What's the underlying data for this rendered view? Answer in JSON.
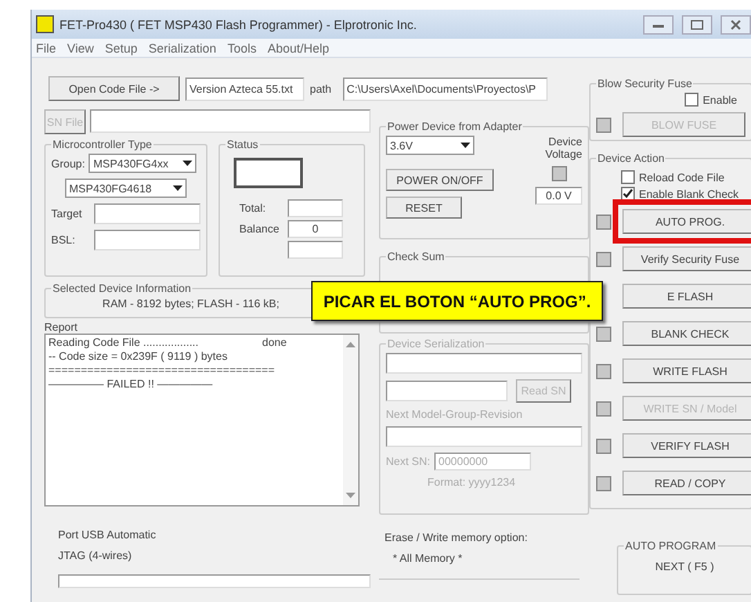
{
  "window": {
    "title": "FET-Pro430  ( FET MSP430 Flash Programmer)  -  Elprotronic Inc."
  },
  "menu": [
    "File",
    "View",
    "Setup",
    "Serialization",
    "Tools",
    "About/Help"
  ],
  "code_file": {
    "button": "Open Code File    ->",
    "file": "Version Azteca 55.txt",
    "path_label": "path",
    "path": "C:\\Users\\Axel\\Documents\\Proyectos\\P"
  },
  "sn_file": {
    "button": "SN File",
    "disabled": true
  },
  "microcontroller_type": {
    "title": "Microcontroller Type",
    "group_label": "Group:",
    "group": "MSP430FG4xx",
    "device": "MSP430FG4618",
    "target_label": "Target",
    "bsl_label": "BSL:"
  },
  "status": {
    "title": "Status",
    "total_label": "Total:",
    "balance_label": "Balance",
    "balance": "0"
  },
  "device_info": {
    "title": "Selected Device Information",
    "text": "RAM - 8192 bytes;    FLASH - 116 kB;"
  },
  "report": {
    "title": "Report",
    "lines": [
      {
        "text": "Reading Code File ..................",
        "result": "done"
      },
      {
        "text": "-- Code size = 0x239F ( 9119 ) bytes"
      },
      {
        "text": "==================================="
      },
      {
        "text": "————— FAILED !! —————"
      }
    ]
  },
  "power": {
    "title": "Power Device from Adapter",
    "voltage": "3.6V",
    "voltage_label": "Device Voltage",
    "power_button": "POWER ON/OFF",
    "reset_button": "RESET",
    "reading": "0.0 V"
  },
  "check_sum": {
    "title": "Check Sum"
  },
  "serialization": {
    "title": "Device Serialization",
    "disabled": true,
    "read_button": "Read SN",
    "next_model_label": "Next Model-Group-Revision",
    "next_sn_label": "Next SN:",
    "next_sn": "00000000",
    "format": "Format: yyyy1234"
  },
  "blow_fuse": {
    "title": "Blow Security Fuse",
    "enable_label": "Enable",
    "enable_checked": false,
    "button": "BLOW FUSE",
    "disabled": true
  },
  "device_action": {
    "title": "Device Action",
    "options": [
      {
        "label": "Reload Code File",
        "checked": false
      },
      {
        "label": "Enable Blank Check",
        "checked": true
      }
    ],
    "buttons": [
      {
        "label": "AUTO PROG.",
        "disabled": false,
        "highlighted": true,
        "led": true
      },
      {
        "label": "Verify Security Fuse",
        "disabled": false,
        "highlighted": false,
        "led": true
      },
      {
        "label": "E FLASH",
        "disabled": false,
        "highlighted": false,
        "led": false
      },
      {
        "label": "BLANK CHECK",
        "disabled": false,
        "highlighted": false,
        "led": true
      },
      {
        "label": "WRITE FLASH",
        "disabled": false,
        "highlighted": false,
        "led": true
      },
      {
        "label": "WRITE SN / Model",
        "disabled": true,
        "highlighted": false,
        "led": true
      },
      {
        "label": "VERIFY FLASH",
        "disabled": false,
        "highlighted": false,
        "led": true
      },
      {
        "label": "READ / COPY",
        "disabled": false,
        "highlighted": false,
        "led": true
      }
    ]
  },
  "port": {
    "line_1": "Port USB Automatic",
    "line_2": "JTAG (4-wires)"
  },
  "erase": {
    "label": "Erase / Write memory option:",
    "value": "* All Memory *"
  },
  "auto_program": {
    "title": "AUTO PROGRAM",
    "button": "NEXT  ( F5 )"
  },
  "annotation": {
    "text": "PICAR EL BOTON “AUTO PROG”."
  }
}
